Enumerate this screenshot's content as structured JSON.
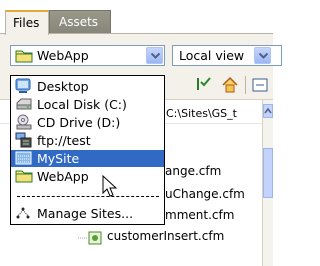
{
  "tabs": [
    {
      "label": "Files",
      "active": true
    },
    {
      "label": "Assets",
      "active": false
    }
  ],
  "site_select": {
    "value": "WebApp"
  },
  "view_select": {
    "value": "Local view"
  },
  "path_text": "C:\\Sites\\GS_t",
  "files": [
    {
      "name": "ange.cfm"
    },
    {
      "name": "uChange.cfm"
    },
    {
      "name": "mment.cfm"
    },
    {
      "name": "customerInsert.cfm"
    }
  ],
  "dropdown": {
    "items": [
      {
        "label": "Desktop",
        "icon": "desktop-icon",
        "selected": false
      },
      {
        "label": "Local Disk (C:)",
        "icon": "local-disk-icon",
        "selected": false
      },
      {
        "label": "CD Drive (D:)",
        "icon": "cd-drive-icon",
        "selected": false
      },
      {
        "label": "ftp://test",
        "icon": "ftp-server-icon",
        "selected": false
      },
      {
        "label": "MySite",
        "icon": "site-icon",
        "selected": true
      },
      {
        "label": "WebApp",
        "icon": "folder-icon",
        "selected": false
      },
      {
        "label": "",
        "icon": "",
        "separator": true
      },
      {
        "label": "Manage Sites...",
        "icon": "manage-sites-icon",
        "selected": false
      }
    ]
  },
  "colors": {
    "accent": "#e0a93a",
    "selection": "#316ac5",
    "border": "#7f9db9"
  }
}
